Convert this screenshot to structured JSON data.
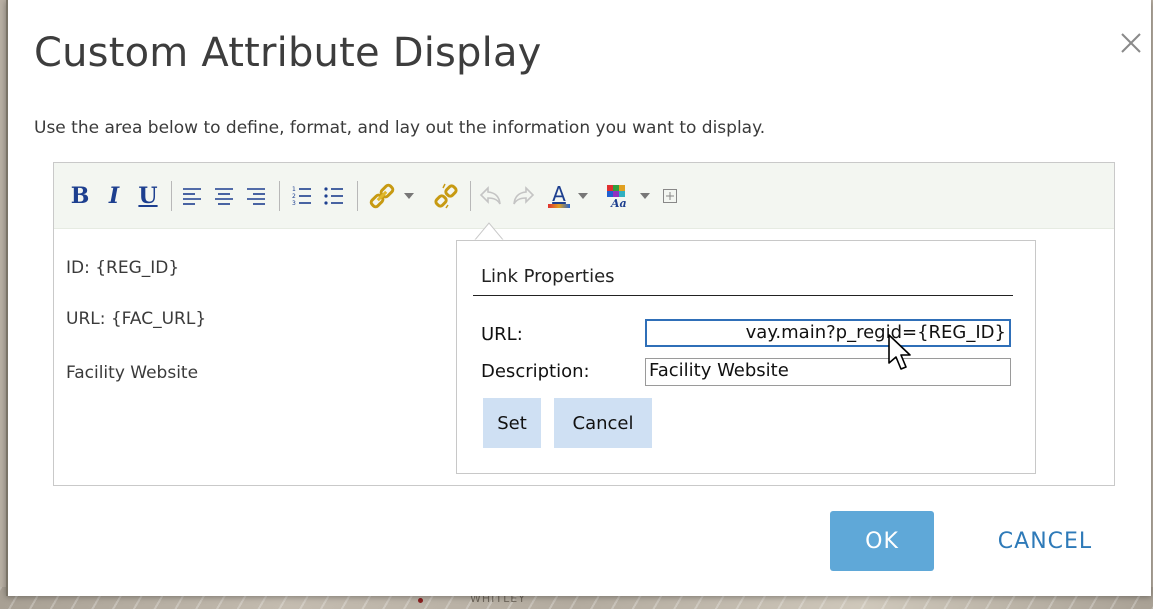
{
  "dialog": {
    "title": "Custom Attribute Display",
    "instructions": "Use the area below to define, format, and lay out the information you want to display.",
    "ok_label": "OK",
    "cancel_label": "CANCEL"
  },
  "toolbar": {
    "bold": "B",
    "italic": "I",
    "underline": "U",
    "font_color_glyph": "A",
    "highlight_glyph": "Aa"
  },
  "editor_content": {
    "line1": "ID: {REG_ID}",
    "line2": "URL:  {FAC_URL}",
    "line3": "Facility Website"
  },
  "link_properties": {
    "title": "Link Properties",
    "url_label": "URL:",
    "url_value": "vay.main?p_regid={REG_ID}",
    "description_label": "Description:",
    "description_value": "Facility Website",
    "set_label": "Set",
    "cancel_label": "Cancel"
  },
  "map": {
    "label": "WHITLEY"
  },
  "colors": {
    "primary_button": "#5fa8d8",
    "link_text": "#2e7ab8",
    "toolbar_icon": "#1d3f8f",
    "popup_button": "#cfe0f3",
    "focus_border": "#2f6fb8"
  },
  "icons": [
    "close-icon",
    "align-left-icon",
    "align-center-icon",
    "align-right-icon",
    "ordered-list-icon",
    "unordered-list-icon",
    "create-link-icon",
    "remove-link-icon",
    "undo-icon",
    "redo-icon",
    "font-color-icon",
    "highlight-color-icon",
    "insert-table-icon",
    "mouse-cursor-icon"
  ]
}
